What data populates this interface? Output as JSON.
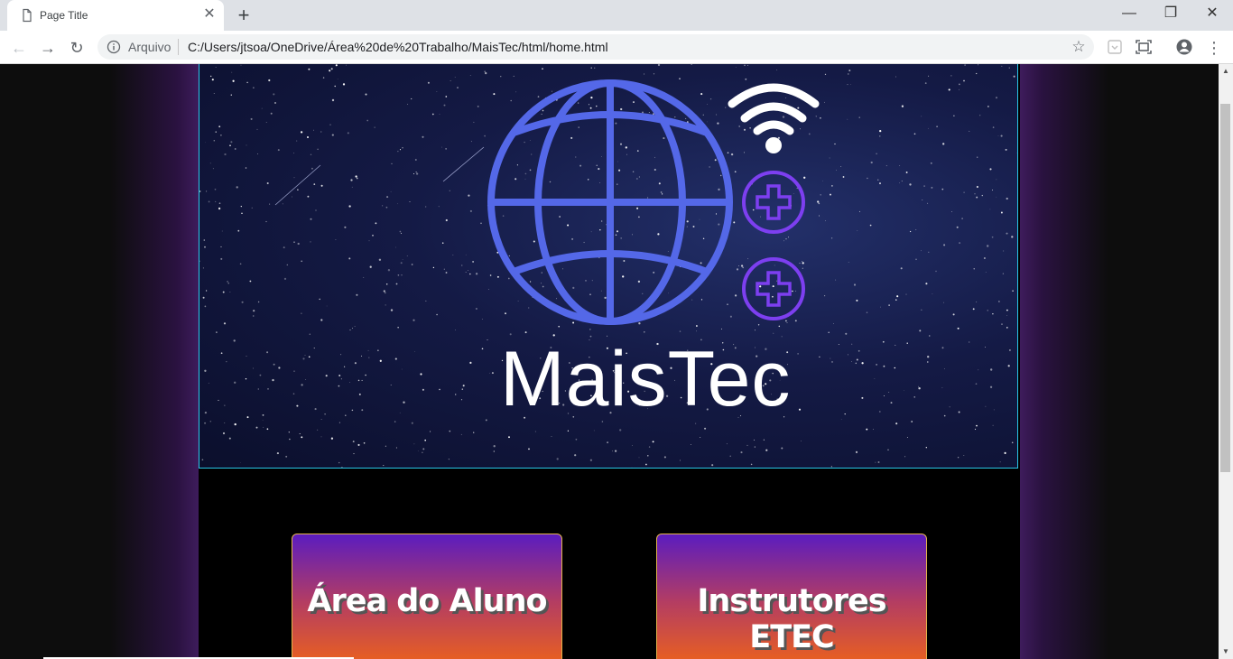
{
  "browser": {
    "tab": {
      "title": "Page Title"
    },
    "address": {
      "scheme": "Arquivo",
      "url": "C:/Users/jtsoa/OneDrive/Área%20de%20Trabalho/MaisTec/html/home.html"
    }
  },
  "page": {
    "brand": "MaisTec",
    "buttons": [
      {
        "label": "Área do Aluno"
      },
      {
        "label": "Instrutores ETEC"
      }
    ]
  },
  "colors": {
    "globe": "#5468e8",
    "plus_circles": "#7d3ff0",
    "banner_border": "#29c6e6",
    "button_top": "#5b1cbf",
    "button_bottom": "#ef6418"
  }
}
